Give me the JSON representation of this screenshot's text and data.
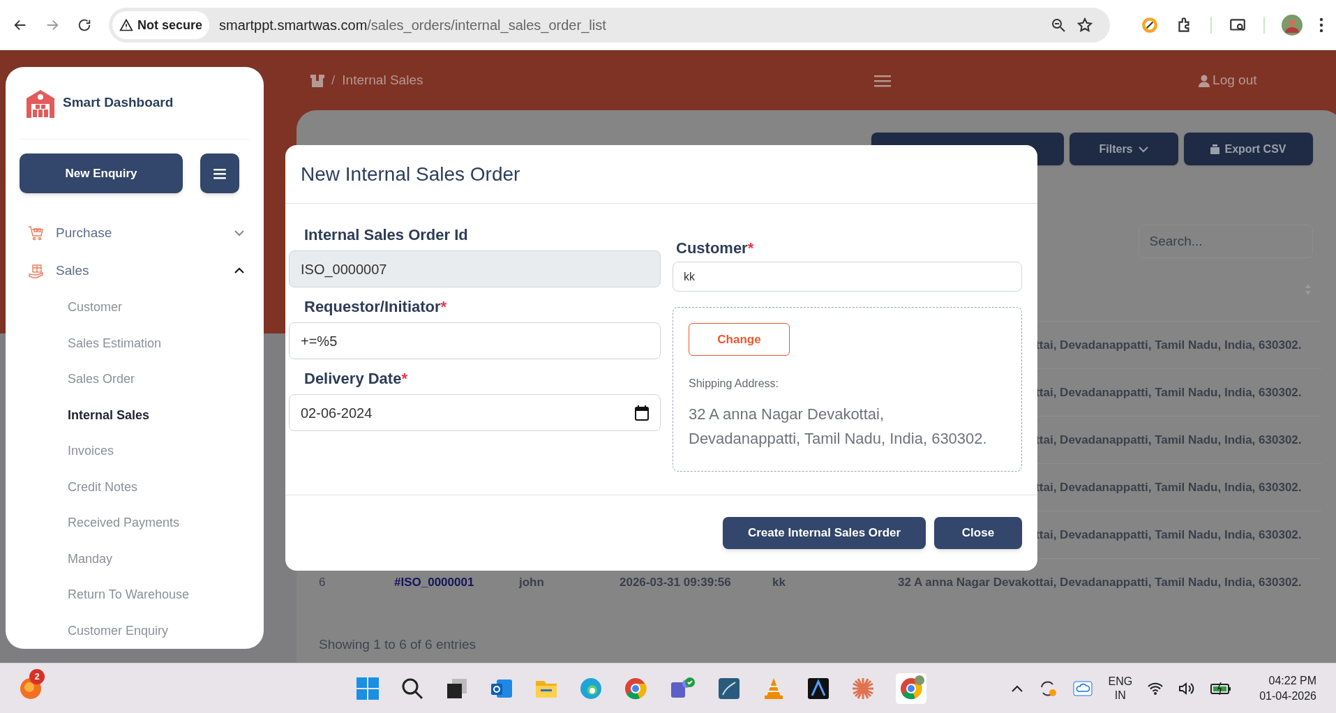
{
  "browser": {
    "security_label": "Not secure",
    "url_host": "smartppt.smartwas.com",
    "url_path": "/sales_orders/internal_sales_order_list"
  },
  "sidebar": {
    "brand": "Smart Dashboard",
    "new_button": "New Enquiry",
    "menu": [
      {
        "label": "Purchase",
        "kind": "cart",
        "expanded": false
      },
      {
        "label": "Sales",
        "kind": "gift",
        "expanded": true,
        "children": [
          {
            "label": "Customer",
            "selected": false
          },
          {
            "label": "Sales Estimation",
            "selected": false
          },
          {
            "label": "Sales Order",
            "selected": false
          },
          {
            "label": "Internal Sales",
            "selected": true
          },
          {
            "label": "Invoices",
            "selected": false
          },
          {
            "label": "Credit Notes",
            "selected": false
          },
          {
            "label": "Received Payments",
            "selected": false
          },
          {
            "label": "Manday",
            "selected": false
          },
          {
            "label": "Return To Warehouse",
            "selected": false
          },
          {
            "label": "Customer Enquiry",
            "selected": false
          }
        ]
      }
    ]
  },
  "header": {
    "separator": "/",
    "breadcrumb": "Internal Sales",
    "logout": "Log out"
  },
  "page": {
    "buttons": [
      {
        "kind": "plain"
      },
      {
        "kind": "dropdown",
        "label": "Filters"
      },
      {
        "kind": "export",
        "label": "Export CSV"
      }
    ],
    "search": {
      "placeholder": "Search..."
    },
    "table": {
      "rows": [
        {
          "column_6": "ttai, Devadanappatti, Tamil Nadu, India, 630302."
        },
        {
          "column_6": "ttai, Devadanappatti, Tamil Nadu, India, 630302."
        },
        {
          "column_6": "ttai, Devadanappatti, Tamil Nadu, India, 630302."
        },
        {
          "column_6": "ttai, Devadanappatti, Tamil Nadu, India, 630302."
        },
        {
          "column_6": "ttai, Devadanappatti, Tamil Nadu, India, 630302."
        },
        {
          "column_1": "6",
          "column_2": "#ISO_0000001",
          "column_3": "john",
          "column_4": "2026-03-31 09:39:56",
          "column_5": "kk",
          "column_6": "32 A anna Nagar Devakottai, Devadanappatti, Tamil Nadu, India, 630302."
        }
      ]
    },
    "footer": "Showing 1 to 6 of 6 entries"
  },
  "modal": {
    "title": "New Internal Sales Order",
    "fields": [
      {
        "kind": "readonly",
        "label": "Internal Sales Order Id",
        "value": "ISO_0000007"
      },
      {
        "kind": "text",
        "label": "Requestor/Initiator",
        "required_mark": "*",
        "value": "+=%5"
      },
      {
        "kind": "date",
        "label": "Delivery Date",
        "required_mark": "*",
        "value": "02-06-2024"
      }
    ],
    "customer": {
      "label": "Customer",
      "required_mark": "*",
      "value": "kk"
    },
    "shipping": {
      "change_button": "Change",
      "label": "Shipping Address:",
      "address": "32 A anna Nagar Devakottai, Devadanappatti, Tamil Nadu, India, 630302."
    },
    "buttons": [
      "Create Internal Sales Order",
      "Close"
    ]
  },
  "taskbar": {
    "badge": "2",
    "language": "ENG",
    "region": "IN",
    "time": "04:22 PM",
    "date": "01-04-2026"
  }
}
